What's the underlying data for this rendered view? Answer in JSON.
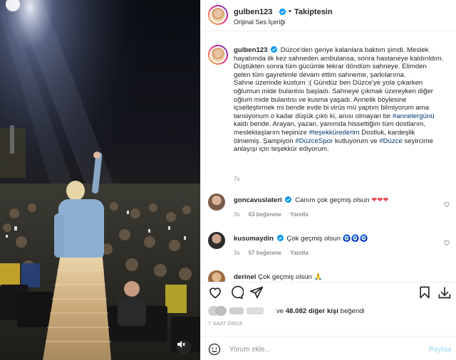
{
  "post": {
    "username": "gulben123",
    "follow_label": "Takiptesin",
    "audio_label": "Orijinal Ses İçeriği",
    "caption_lines": [
      "Düzce'den geriye kalanlara baktım şimdi. Meslek",
      "hayatımda ilk kez sahneden ambulansa, sonra hastaneye kaldırıldım.",
      "Düştükten sonra tüm gücümle tekrar döndüm sahneye. Elimden",
      "gelen tüm gayretimle devam ettim sahneme, şarkılarıma.",
      "Sahne üzerinde kustum :( Gündüz ben Düzce'ye yola çıkarken",
      "oğlumun mide bulantısı başladı. Sahneye çıkmak üzereyken diğer",
      "oğlum mide bulantısı ve kusma yaşadı. Annelik böylesine",
      "içselleştirmek mi bende evde bi virüs mü yaptım bilmiyorum ama",
      "tansiyonum o kadar düşük çıktı ki, anısı olmayan bir",
      "kaldı bende. Arayan, yazan, yanımda hissettiğim tüm dostlarım,",
      "meslektaşlarım hepinize",
      "ölmemiş. Şampiyon",
      "anlayışı için teşekkür ediyorum."
    ],
    "hashtags": {
      "annelergunu": "#annelergünü",
      "tesekkurederim": "#teşekkürederim",
      "duzcespor": "#DüzceSpor",
      "duzce": "#Düzce"
    },
    "caption_fragments": {
      "after_tesekkur": " Dostluk, kardeşlik",
      "after_duzcespor": " kutluyorum ve ",
      "after_duzce": " seyircime"
    },
    "caption_time": "7s"
  },
  "comments": [
    {
      "username": "goncavuslateri",
      "text": "Canım çok geçmiş olsun",
      "emoji": "❤❤❤",
      "time": "3s",
      "likes": "63 beğenme",
      "reply_label": "Yanıtla"
    },
    {
      "username": "kusumaydin",
      "text": "Çok geçmiş olsun",
      "emoji": "🧿🧿🧿",
      "time": "3s",
      "likes": "57 beğenme",
      "reply_label": "Yanıtla"
    },
    {
      "username": "derinel",
      "text": "Çok geçmiş olsun 🙏"
    }
  ],
  "likes": {
    "connector": "ve",
    "count_text": "48.082 diğer kişi",
    "suffix": "beğendi"
  },
  "post_time": "7 SAAT ÖNCE",
  "add_comment": {
    "placeholder": "Yorum ekle...",
    "post_label": "Paylaş"
  },
  "icons": {
    "like": "heart-icon",
    "comment": "comment-icon",
    "share": "send-icon",
    "save": "bookmark-icon",
    "download": "download-icon",
    "emoji": "emoji-icon",
    "mute": "speaker-muted-icon"
  },
  "colors": {
    "link": "#00376b",
    "verified": "#0095f6",
    "muted_text": "#8e8e8e",
    "post_button": "#b2dffc",
    "heart_red": "#ed4956"
  }
}
